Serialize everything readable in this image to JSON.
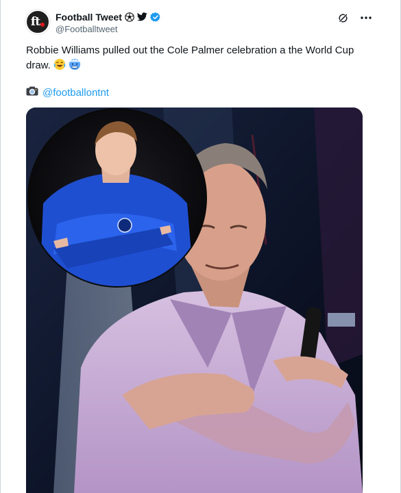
{
  "author": {
    "avatar_text": "ft",
    "display_name": "Football Tweet",
    "handle": "@Footballtweet",
    "badge_icons": [
      "soccer-ball-icon",
      "twitter-bird-icon",
      "verified-badge-icon"
    ]
  },
  "actions": {
    "grok_icon": "grok-icon",
    "more_icon": "more-icon"
  },
  "tweet": {
    "text": "Robbie Williams pulled out the Cole Palmer celebration a the World Cup draw.",
    "emojis": [
      "laughing-emoji",
      "cold-face-emoji"
    ],
    "source_icon": "camera-icon",
    "source_handle": "@footballontnt"
  },
  "colors": {
    "link": "#1d9bf0",
    "verified": "#1d9bf0",
    "handle": "#536471",
    "chelsea_blue": "#1f4fd1",
    "suit_lilac": "#c8afd6"
  }
}
